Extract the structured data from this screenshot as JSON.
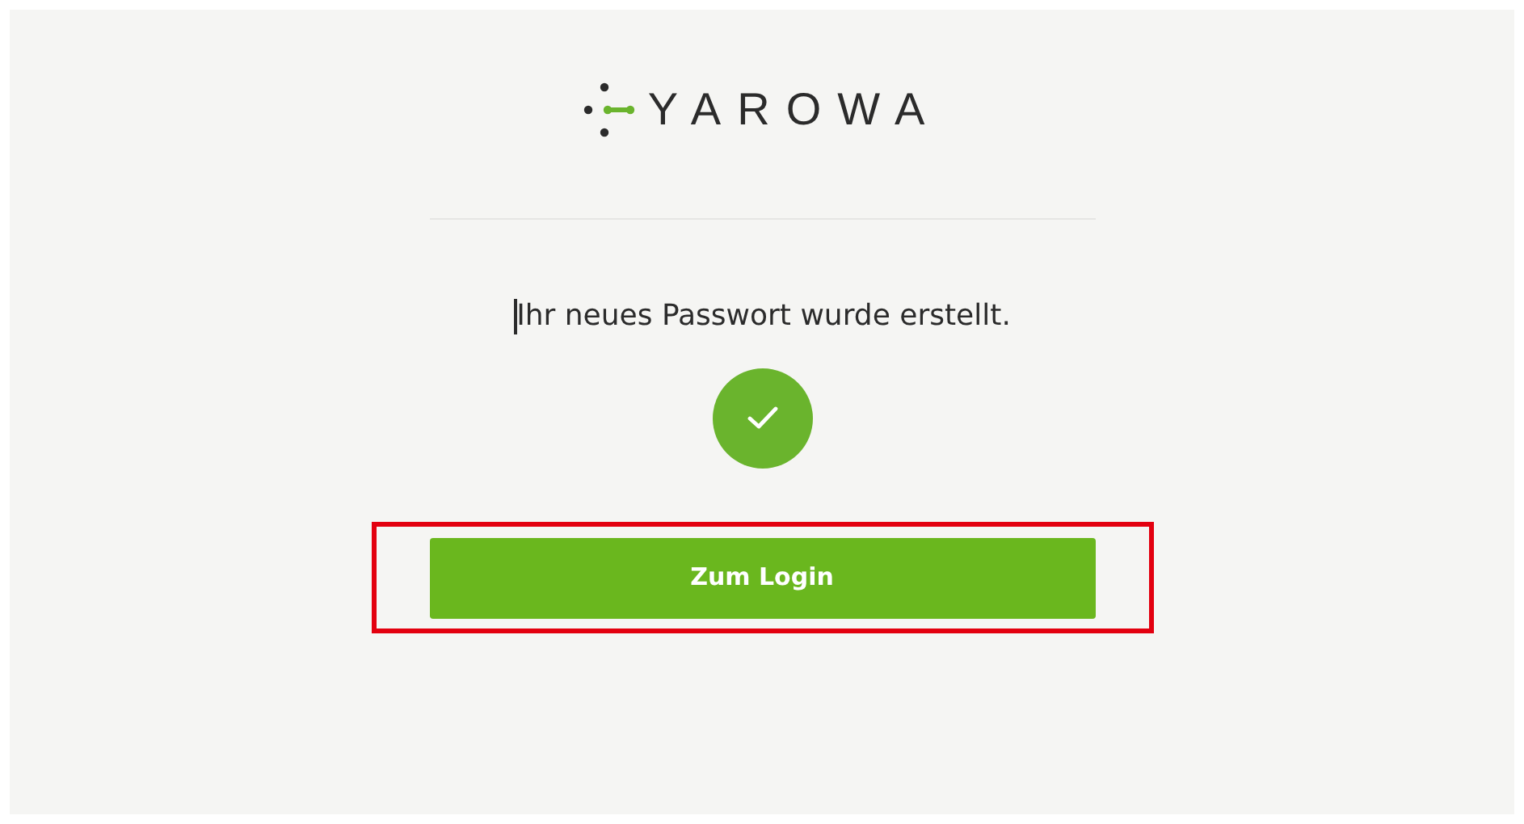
{
  "logo": {
    "text": "YAROWA"
  },
  "message": "Ihr neues Passwort wurde erstellt.",
  "button": {
    "label": "Zum Login",
    "highlighted": true
  }
}
